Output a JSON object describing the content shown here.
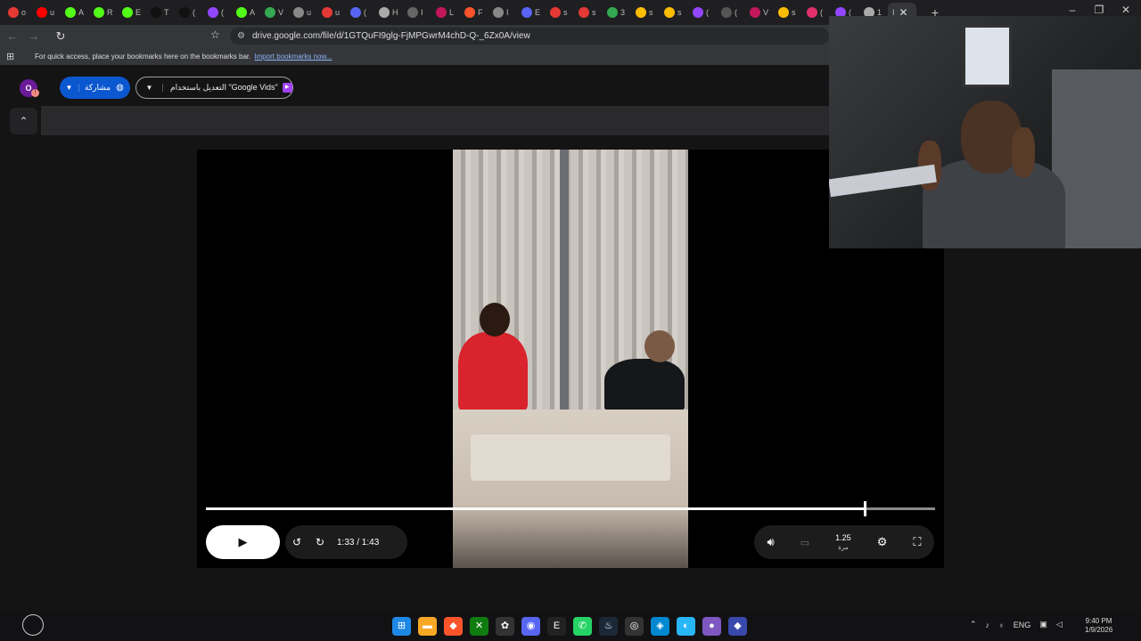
{
  "browser": {
    "tabs": [
      {
        "label": "o",
        "color": "#e53935"
      },
      {
        "label": "u",
        "color": "#ff0000"
      },
      {
        "label": "A",
        "color": "#53fc18"
      },
      {
        "label": "R",
        "color": "#53fc18"
      },
      {
        "label": "E",
        "color": "#53fc18"
      },
      {
        "label": "T",
        "color": "#111111"
      },
      {
        "label": "(",
        "color": "#111111"
      },
      {
        "label": "(",
        "color": "#9146ff"
      },
      {
        "label": "A",
        "color": "#53fc18"
      },
      {
        "label": "V",
        "color": "#34a853"
      },
      {
        "label": "u",
        "color": "#888888"
      },
      {
        "label": "u",
        "color": "#e53935"
      },
      {
        "label": "(",
        "color": "#5865f2"
      },
      {
        "label": "H",
        "color": "#aaaaaa"
      },
      {
        "label": "I",
        "color": "#666666"
      },
      {
        "label": "L",
        "color": "#c2185b"
      },
      {
        "label": "F",
        "color": "#fb542b"
      },
      {
        "label": "I",
        "color": "#888888"
      },
      {
        "label": "E",
        "color": "#5865f2"
      },
      {
        "label": "s",
        "color": "#e53935"
      },
      {
        "label": "s",
        "color": "#e53935"
      },
      {
        "label": "3",
        "color": "#34a853"
      },
      {
        "label": "s",
        "color": "#fbbc04"
      },
      {
        "label": "s",
        "color": "#fbbc04"
      },
      {
        "label": "(",
        "color": "#9146ff"
      },
      {
        "label": "(",
        "color": "#555555"
      },
      {
        "label": "V",
        "color": "#c2185b"
      },
      {
        "label": "s",
        "color": "#fbbc04"
      },
      {
        "label": "(",
        "color": "#e1306c"
      },
      {
        "label": "(",
        "color": "#9146ff"
      },
      {
        "label": "1",
        "color": "#aaaaaa"
      }
    ],
    "active_tab_label": "I",
    "url": "drive.google.com/file/d/1GTQuFI9glg-FjMPGwrM4chD-Q-_6Zx0A/view",
    "bookmarks_message": "For quick access, place your bookmarks here on the bookmarks bar.",
    "import_bookmarks": "Import bookmarks now..."
  },
  "drive": {
    "avatar_initial": "O",
    "share_label": "مشاركة",
    "open_with_label": "التعديل باستخدام \"Google Vids\""
  },
  "player": {
    "time_display": "1:33 / 1:43",
    "progress_fraction": 0.903,
    "speed_value": "1.25",
    "speed_unit": "مرة"
  },
  "system": {
    "language": "ENG",
    "time": "9:40 PM",
    "date": "1/9/2026"
  },
  "colors": {
    "share_button": "#0b57d0",
    "vids_icon": "#a142f4"
  }
}
